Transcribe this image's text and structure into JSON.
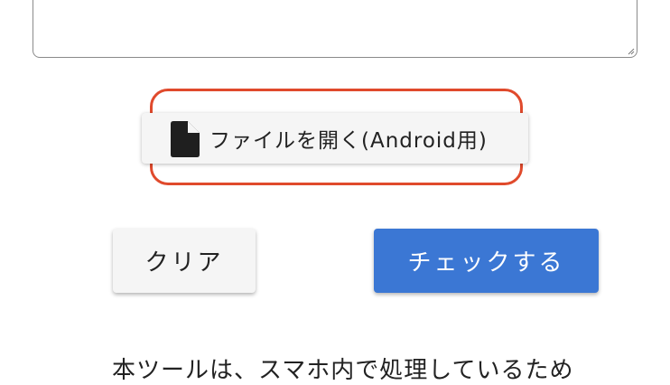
{
  "textarea": {
    "value": ""
  },
  "file_button": {
    "label": "ファイルを開く(Android用)",
    "icon": "file-icon"
  },
  "actions": {
    "clear_label": "クリア",
    "check_label": "チェックする"
  },
  "notice": {
    "text": "本ツールは、スマホ内で処理しているため"
  },
  "colors": {
    "highlight_border": "#e04a2c",
    "check_button_bg": "#3b77d4",
    "button_bg": "#f5f5f5"
  }
}
